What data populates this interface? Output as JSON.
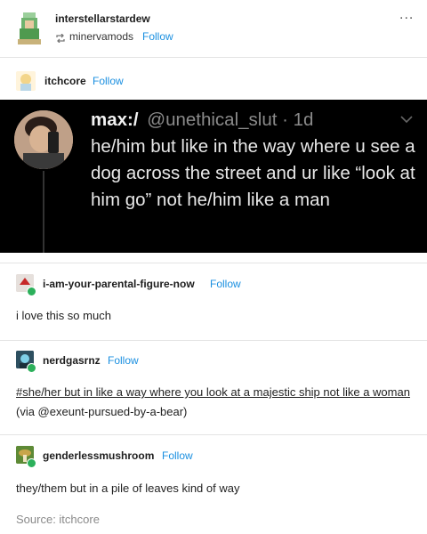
{
  "post_header": {
    "author": "interstellarstardew",
    "reblogged_from": "minervamods",
    "follow_label": "Follow",
    "more_label": "..."
  },
  "op": {
    "username": "itchcore",
    "follow_label": "Follow"
  },
  "tweet": {
    "display_name": "max:/",
    "handle_time": "@unethical_slut · 1d",
    "text": "he/him but like in the way where u see a dog across the street and ur like “look at him go” not he/him like a man"
  },
  "reblogs": [
    {
      "username": "i-am-your-parental-figure-now",
      "follow_label": "Follow",
      "text": "i love this so much"
    },
    {
      "username": "nerdgasrnz",
      "follow_label": "Follow",
      "text_link": "#she/her but in like a way where you look at a majestic ship not like a woman",
      "text_via": "(via @exeunt-pursued-by-a-bear)"
    },
    {
      "username": "genderlessmushroom",
      "follow_label": "Follow",
      "text": "they/them but in a pile of leaves kind of way"
    }
  ],
  "source": {
    "label": "Source: itchcore"
  },
  "colors": {
    "link": "#1a8fe0",
    "tweet_bg": "#000000",
    "reblog_badge": "#2cb05b"
  }
}
